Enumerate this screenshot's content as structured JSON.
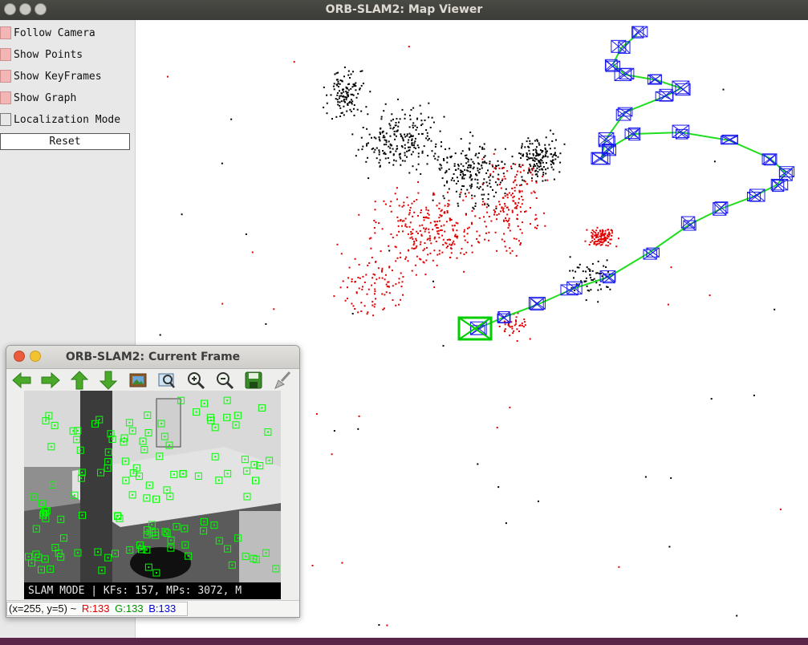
{
  "window": {
    "title": "ORB-SLAM2: Map Viewer"
  },
  "panel": {
    "items": [
      {
        "label": "Follow Camera",
        "checked": true
      },
      {
        "label": "Show Points",
        "checked": true
      },
      {
        "label": "Show KeyFrames",
        "checked": true
      },
      {
        "label": "Show Graph",
        "checked": true
      },
      {
        "label": "Localization Mode",
        "checked": false
      }
    ],
    "reset_label": "Reset"
  },
  "map": {
    "colors": {
      "points": "#000000",
      "local_points": "#e00000",
      "keyframes": "#1a1aee",
      "graph": "#20dd20",
      "current_camera": "#00cc00"
    }
  },
  "frame_window": {
    "title": "ORB-SLAM2: Current Frame",
    "toolbar": [
      {
        "icon": "arrow-left-icon",
        "label": "Back"
      },
      {
        "icon": "arrow-right-icon",
        "label": "Forward"
      },
      {
        "icon": "arrow-up-icon",
        "label": "Up"
      },
      {
        "icon": "arrow-down-icon",
        "label": "Down"
      },
      {
        "icon": "image-icon",
        "label": "Image"
      },
      {
        "icon": "zoom-fit-icon",
        "label": "Zoom fit"
      },
      {
        "icon": "zoom-in-icon",
        "label": "Zoom in"
      },
      {
        "icon": "zoom-out-icon",
        "label": "Zoom out"
      },
      {
        "icon": "save-icon",
        "label": "Save"
      },
      {
        "icon": "brush-icon",
        "label": "Brush"
      }
    ],
    "overlay_text": "SLAM MODE |  KFs: 157, MPs: 3072, M",
    "status": {
      "coords": "(x=255, y=5) ~",
      "r": "R:133",
      "g": "G:133",
      "b": "B:133",
      "r_color": "#e00000",
      "g_color": "#009000",
      "b_color": "#0000e0"
    }
  }
}
